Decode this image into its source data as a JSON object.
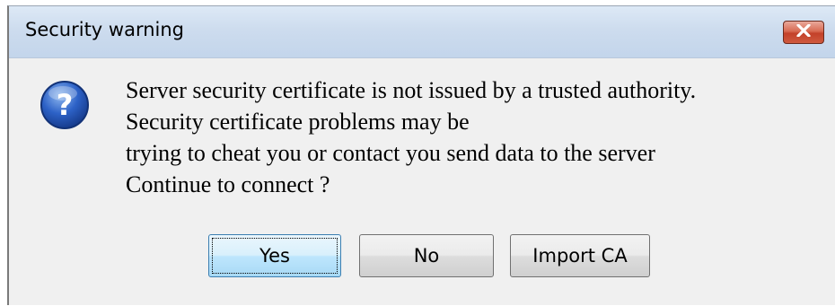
{
  "dialog": {
    "title": "Security warning",
    "close_icon": "close-icon",
    "message_icon": "question-icon",
    "message_lines": [
      "Server security certificate is not issued by a trusted authority.",
      "Security certificate problems may be",
      "trying to cheat you or contact you send data to the server",
      "Continue to connect ?"
    ],
    "buttons": {
      "yes": "Yes",
      "no": "No",
      "import_ca": "Import CA"
    }
  }
}
